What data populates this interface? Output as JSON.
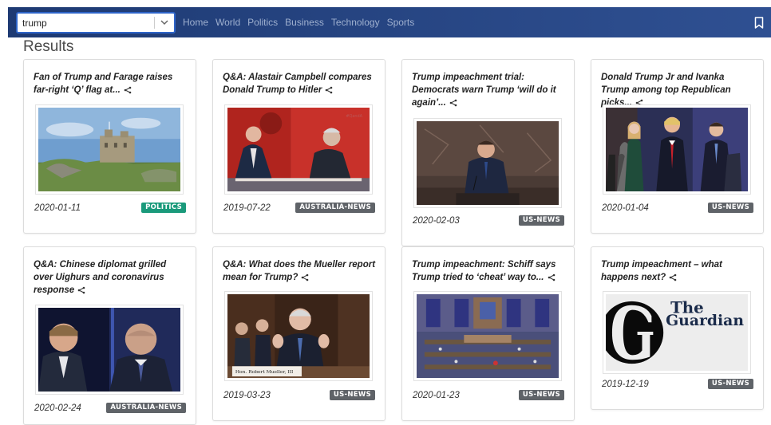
{
  "search": {
    "value": "trump"
  },
  "nav": {
    "items": [
      "Home",
      "World",
      "Politics",
      "Business",
      "Technology",
      "Sports"
    ]
  },
  "results_title": "Results",
  "cards": [
    {
      "title": "Fan of Trump and Farage raises far-right ‘Q’ flag at...",
      "date": "2020-01-11",
      "tag": "POLITICS",
      "tag_color": "#1a9a7b",
      "image": "castle-on-island"
    },
    {
      "title": "Q&A: Alastair Campbell compares Donald Trump to Hitler",
      "date": "2019-07-22",
      "tag": "AUSTRALIA-NEWS",
      "tag_color": "#5f6368",
      "image": "tv-panel-discussion"
    },
    {
      "title": "Trump impeachment trial: Democrats warn Trump ‘will do it again’...",
      "date": "2020-02-03",
      "tag": "US-NEWS",
      "tag_color": "#5f6368",
      "image": "man-at-podium"
    },
    {
      "title": "Donald Trump Jr and Ivanka Trump among top Republican picks...",
      "date": "2020-01-04",
      "tag": "US-NEWS",
      "tag_color": "#5f6368",
      "image": "trump-family"
    },
    {
      "title": "Q&A: Chinese diplomat grilled over Uighurs and coronavirus response",
      "date": "2020-02-24",
      "tag": "AUSTRALIA-NEWS",
      "tag_color": "#5f6368",
      "image": "diplomat-interview"
    },
    {
      "title": "Q&A: What does the Mueller report mean for Trump?",
      "date": "2019-03-23",
      "tag": "US-NEWS",
      "tag_color": "#5f6368",
      "image": "mueller-hearing",
      "image_caption": "Hon. Robert Mueller, III"
    },
    {
      "title": "Trump impeachment: Schiff says Trump tried to ‘cheat’ way to...",
      "date": "2020-01-23",
      "tag": "US-NEWS",
      "tag_color": "#5f6368",
      "image": "senate-chamber"
    },
    {
      "title": "Trump impeachment – what happens next?",
      "date": "2019-12-19",
      "tag": "US-NEWS",
      "tag_color": "#5f6368",
      "image": "guardian-logo",
      "logo_text": [
        "The",
        "Guardian"
      ]
    }
  ],
  "icons": {
    "search_dropdown": "chevron-down-icon",
    "bookmark": "bookmark-icon",
    "share": "share-icon"
  },
  "colors": {
    "header_left": "#1e3a73",
    "header_right": "#2f5092",
    "search_border": "#2e64c8",
    "nav_text": "#9fb0cf"
  }
}
